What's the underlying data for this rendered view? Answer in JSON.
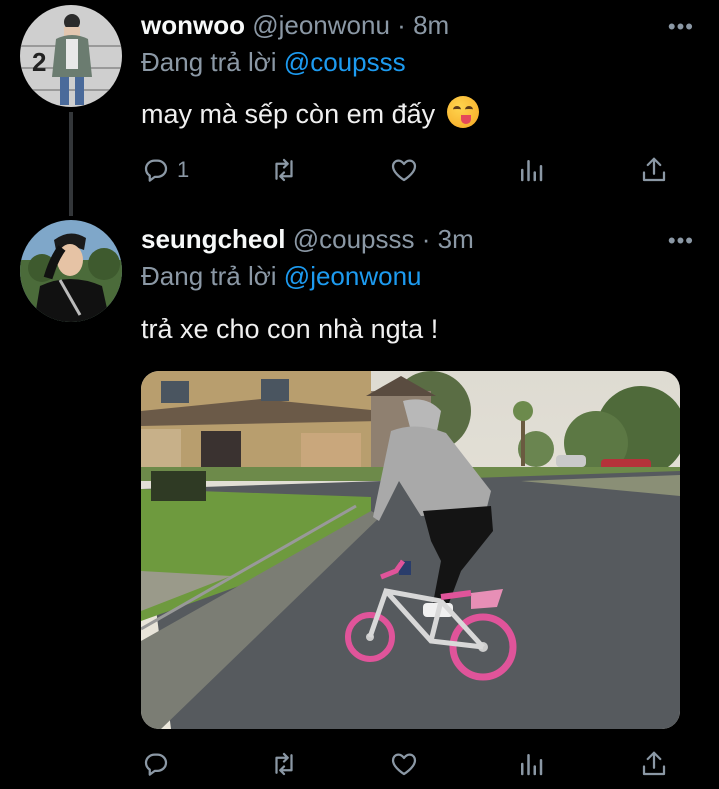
{
  "tweets": [
    {
      "name": "wonwoo",
      "handle": "@jeonwonu",
      "dot": "·",
      "time": "8m",
      "replying_to_prefix": "Đang trả lời",
      "replying_to": "@coupsss",
      "text": "may mà sếp còn em đấy",
      "emoji": "face-savoring-food-emoji",
      "avatar_badge": "2",
      "reply_count": "1",
      "retweet_count": "",
      "like_count": ""
    },
    {
      "name": "seungcheol",
      "handle": "@coupsss",
      "dot": "·",
      "time": "3m",
      "replying_to_prefix": "Đang trả lời",
      "replying_to": "@jeonwonu",
      "text": "trả xe cho con nhà ngta !",
      "reply_count": "",
      "retweet_count": "",
      "like_count": ""
    }
  ],
  "more_label": "•••",
  "colors": {
    "background": "#000000",
    "accent": "#1d9bf0",
    "muted": "#8b98a5",
    "thread_line": "#333639"
  },
  "icons": [
    "reply-icon",
    "retweet-icon",
    "like-icon",
    "analytics-icon",
    "share-icon",
    "more-icon"
  ]
}
